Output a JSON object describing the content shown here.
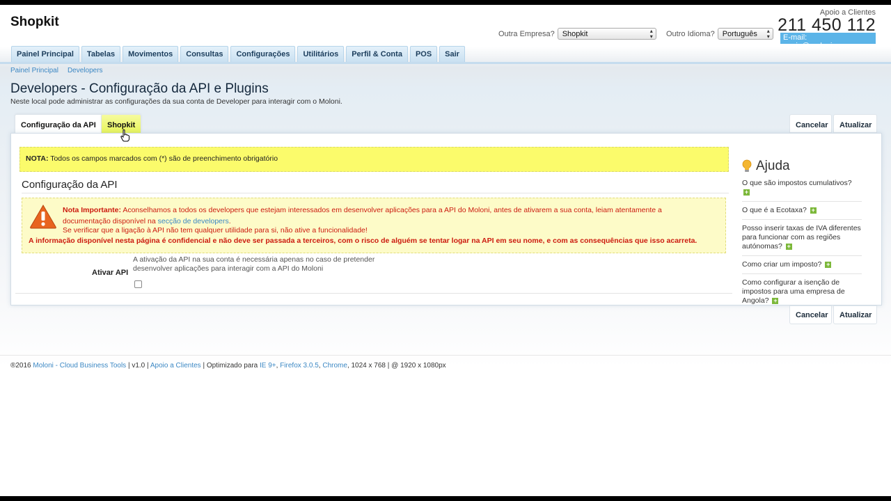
{
  "header": {
    "logo": "Shopkit",
    "company_label": "Outra Empresa?",
    "company_value": "Shopkit",
    "lang_label": "Outro Idioma?",
    "lang_value": "Português",
    "support_label": "Apoio a Clientes",
    "phone": "211 450 112",
    "email": "E-mail: apoio@moloni.com"
  },
  "nav": [
    "Painel Principal",
    "Tabelas",
    "Movimentos",
    "Consultas",
    "Configurações",
    "Utilitários",
    "Perfil & Conta",
    "POS",
    "Sair"
  ],
  "breadcrumb": [
    "Painel Principal",
    "Developers"
  ],
  "page": {
    "title": "Developers - Configuração da API e Plugins",
    "subtitle": "Neste local pode administrar as configurações da sua conta de Developer para interagir com o Moloni."
  },
  "tabs": [
    "Configuração da API",
    "Shopkit"
  ],
  "buttons": {
    "cancel": "Cancelar",
    "update": "Atualizar"
  },
  "nota": {
    "label": "NOTA:",
    "text": "Todos os campos marcados com (*) são de preenchimento obrigatório"
  },
  "section_title": "Configuração da API",
  "warning": {
    "label": "Nota Importante:",
    "line1": "Aconselhamos a todos os developers que estejam interessados em desenvolver aplicações para a API do Moloni, antes de ativarem a sua conta, leiam atentamente a documentação disponível na",
    "link": "secção de developers",
    "line1_end": ".",
    "line2": "Se verificar que a ligação à API não tem qualquer utilidade para si, não ative a funcionalidade!",
    "line3": "A informação disponível nesta página é confidencial e não deve ser passada a terceiros, com o risco de alguém se tentar logar na API em seu nome, e com as consequências que isso acarreta."
  },
  "field": {
    "label": "Ativar API",
    "help": "A ativação da API na sua conta é necessária apenas no caso de pretender desenvolver aplicações para interagir com a API do Moloni"
  },
  "help": {
    "title": "Ajuda",
    "items": [
      "O que são impostos cumulativos?",
      "O que é a Ecotaxa?",
      "Posso inserir taxas de IVA diferentes para funcionar com as regiões autónomas?",
      "Como criar um imposto?",
      "Como configurar a isenção de impostos para uma empresa de Angola?"
    ]
  },
  "footer": {
    "copyright": "®2016",
    "brand": "Moloni - Cloud Business Tools",
    "version": "| v1.0 |",
    "support": "Apoio a Clientes",
    "optimized": "| Optimizado para",
    "ie": "IE 9+",
    "firefox": "Firefox 3.0.5",
    "chrome": "Chrome",
    "res": ", 1024 x 768 |  @ 1920 x 1080px"
  },
  "colors": {
    "accent": "#3c88c4",
    "warning_text": "#cc1b0f",
    "nota_bg": "#fbfb6b",
    "email_bg": "#5bb4e8",
    "plus_green": "#7cb83a"
  }
}
